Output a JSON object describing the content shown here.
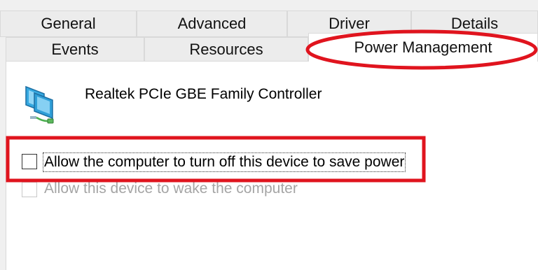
{
  "tabs": {
    "row1": [
      "General",
      "Advanced",
      "Driver",
      "Details"
    ],
    "row2": [
      "Events",
      "Resources",
      "Power Management"
    ],
    "active": "Power Management"
  },
  "device": {
    "name": "Realtek PCIe GBE Family Controller",
    "icon": "network-adapter-icon"
  },
  "options": [
    {
      "label": "Allow the computer to turn off this device to save power",
      "checked": false,
      "enabled": true
    },
    {
      "label": "Allow this device to wake the computer",
      "checked": false,
      "enabled": false
    }
  ],
  "annotation_color": "#e0141e"
}
